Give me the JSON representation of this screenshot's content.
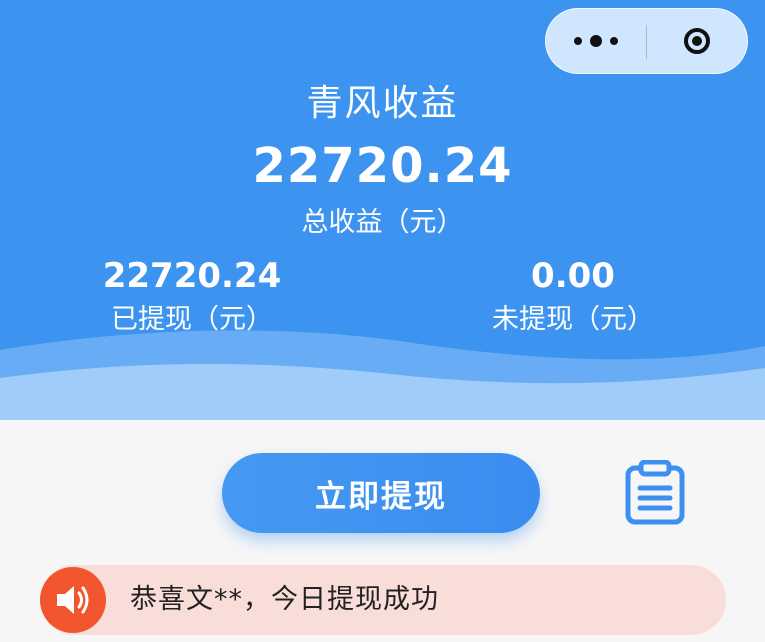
{
  "colors": {
    "header_blue": "#3d93f0",
    "button_blue": "#3a8cef",
    "notice_bg": "#f8ddd8",
    "speaker_red": "#f2562e"
  },
  "header": {
    "title": "青风收益",
    "total_amount": "22720.24",
    "total_label": "总收益（元）",
    "withdrawn_amount": "22720.24",
    "withdrawn_label": "已提现（元）",
    "unwithdrawn_amount": "0.00",
    "unwithdrawn_label": "未提现（元）"
  },
  "capsule": {
    "more_icon": "more-dots-icon",
    "close_icon": "close-target-icon"
  },
  "actions": {
    "withdraw_label": "立即提现",
    "records_icon": "clipboard-list-icon"
  },
  "notice": {
    "icon": "speaker-icon",
    "text": "恭喜文**，今日提现成功"
  }
}
